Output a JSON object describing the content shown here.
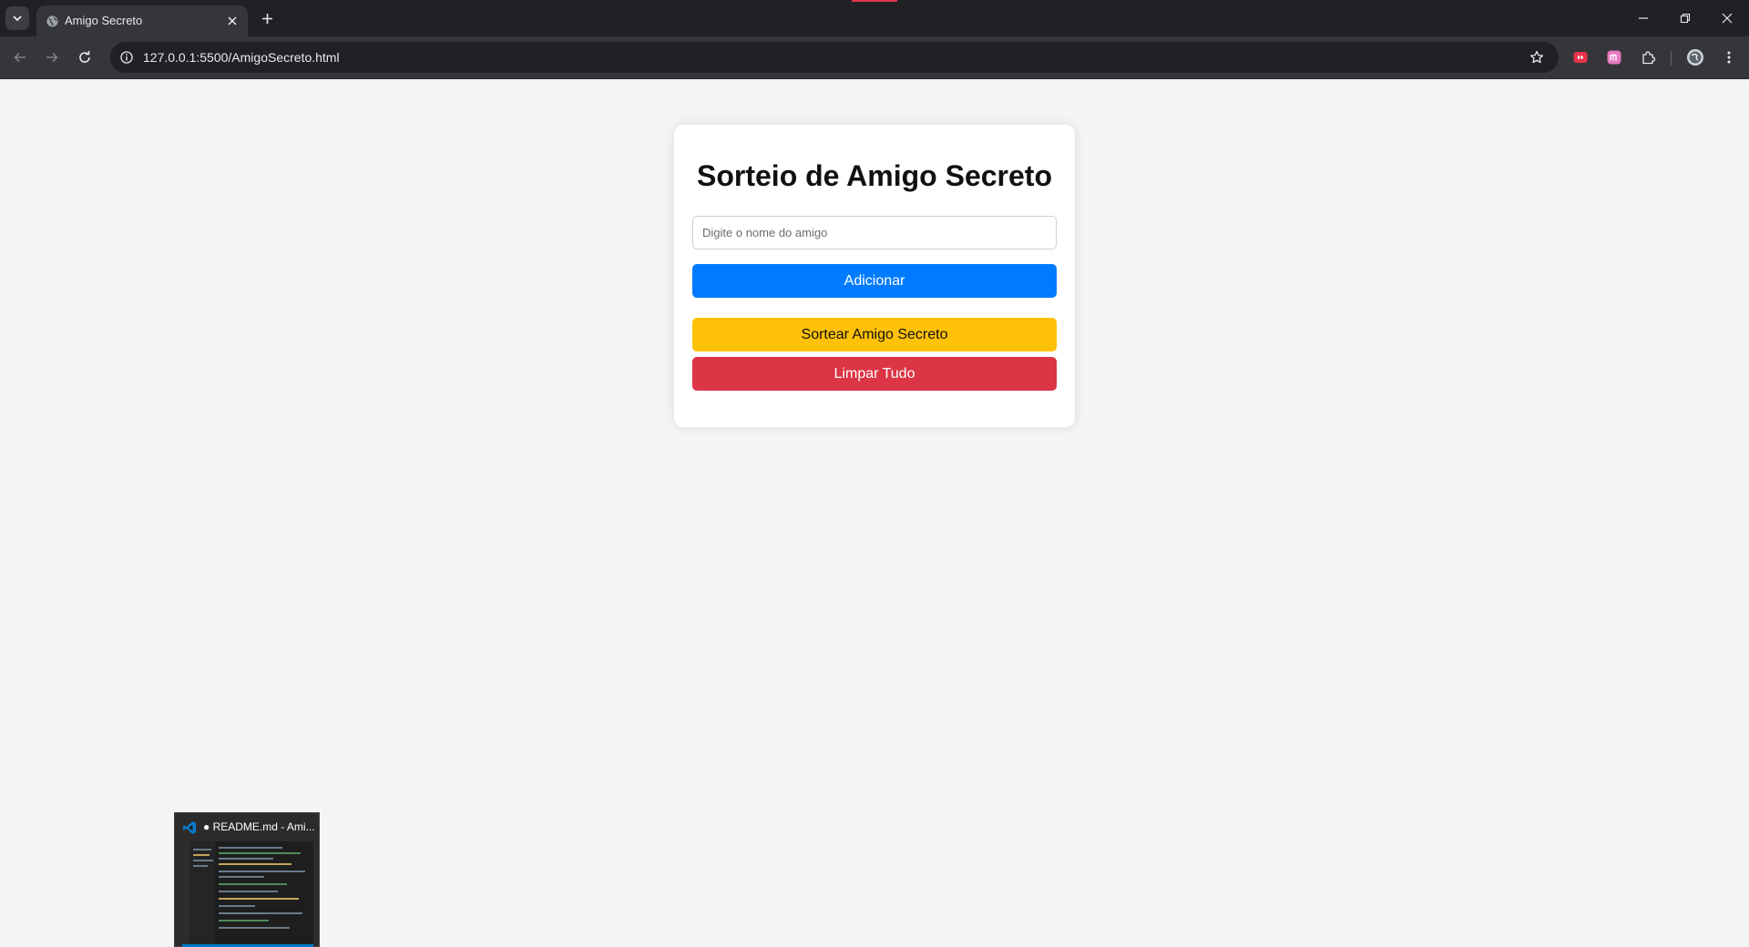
{
  "browser": {
    "tab_title": "Amigo Secreto",
    "url": "127.0.0.1:5500/AmigoSecreto.html",
    "icons": {
      "tab_search": "chevron-down-icon",
      "favicon": "globe-icon",
      "tab_close": "close-icon",
      "new_tab": "plus-icon",
      "back": "arrow-left-icon",
      "forward": "arrow-right-icon",
      "reload": "reload-icon",
      "site_info": "info-icon",
      "bookmark": "star-icon",
      "extensions": "puzzle-icon",
      "menu": "kebab-menu-icon"
    },
    "colors": {
      "frame": "#202124",
      "toolbar": "#35363a",
      "omnibox": "#202124"
    }
  },
  "page": {
    "title": "Sorteio de Amigo Secreto",
    "input_placeholder": "Digite o nome do amigo",
    "input_value": "",
    "add_button": "Adicionar",
    "draw_button": "Sortear Amigo Secreto",
    "clear_button": "Limpar Tudo",
    "colors": {
      "background": "#f4f4f4",
      "card": "#ffffff",
      "add": "#007bff",
      "draw": "#ffc107",
      "clear": "#dc3545"
    }
  },
  "taskbar_preview": {
    "title": "● README.md - Ami...",
    "app_icon": "vscode-icon"
  }
}
